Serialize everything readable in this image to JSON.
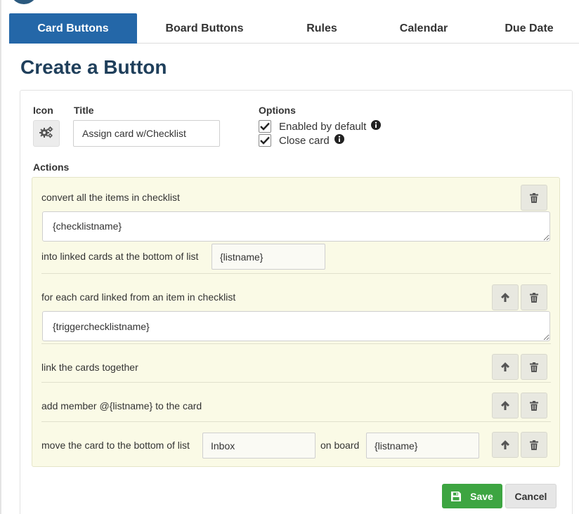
{
  "tabs": [
    {
      "label": "Card Buttons",
      "active": true
    },
    {
      "label": "Board Buttons",
      "active": false
    },
    {
      "label": "Rules",
      "active": false
    },
    {
      "label": "Calendar",
      "active": false
    },
    {
      "label": "Due Date",
      "active": false
    }
  ],
  "page_title": "Create a Button",
  "form": {
    "icon_label": "Icon",
    "icon_name": "gears-icon",
    "title_label": "Title",
    "title_value": "Assign card w/Checklist",
    "options_label": "Options",
    "options": [
      {
        "label": "Enabled by default",
        "checked": true
      },
      {
        "label": "Close card",
        "checked": true
      }
    ],
    "actions_label": "Actions"
  },
  "actions": {
    "a1": {
      "text": "convert all the items in checklist",
      "field": "{checklistname}",
      "text2": "into linked cards at the bottom of list",
      "list": "{listname}"
    },
    "a2": {
      "text": "for each card linked from an item in checklist",
      "field": "{triggerchecklistname}"
    },
    "a3": {
      "text": "link the cards together"
    },
    "a4": {
      "text": "add member @{listname} to the card"
    },
    "a5": {
      "text": "move the card to the bottom of list",
      "list": "Inbox",
      "text2": "on board",
      "board": "{listname}"
    }
  },
  "footer": {
    "save_label": "Save",
    "cancel_label": "Cancel"
  },
  "colors": {
    "accent": "#2467a8",
    "save": "#3da541",
    "actions_bg": "#fafae6",
    "title": "#1f3f5b"
  }
}
